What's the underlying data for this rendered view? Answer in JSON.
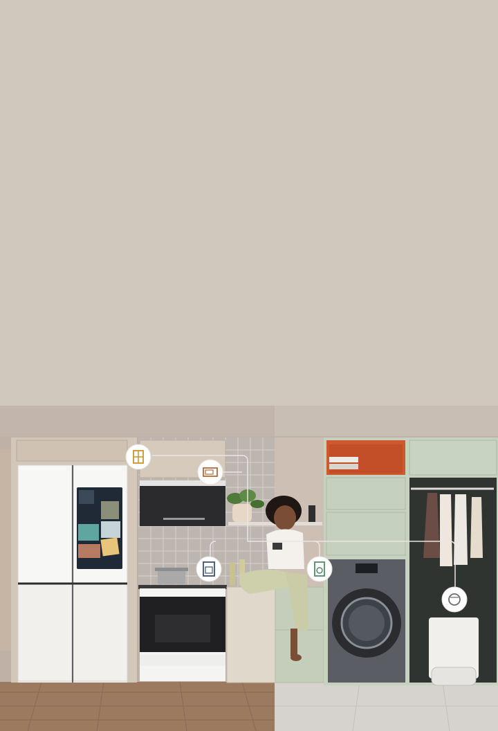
{
  "image": {
    "subject": "smart-home-appliances",
    "connection_icons": [
      "fridge-icon",
      "microwave-icon",
      "oven-icon",
      "washer-icon",
      "robot-vacuum-icon"
    ]
  },
  "colors": {
    "background": "#d1c8bd",
    "wall": "#c9bdb3",
    "cabinet_green": "#c4cfbf",
    "accent_orange": "#d0582e",
    "floor_wood": "#9c7a60",
    "floor_tile": "#d8d4cf",
    "icon_gold": "#c9962e",
    "icon_brown": "#b26a3c",
    "icon_green": "#4f8a6a"
  }
}
